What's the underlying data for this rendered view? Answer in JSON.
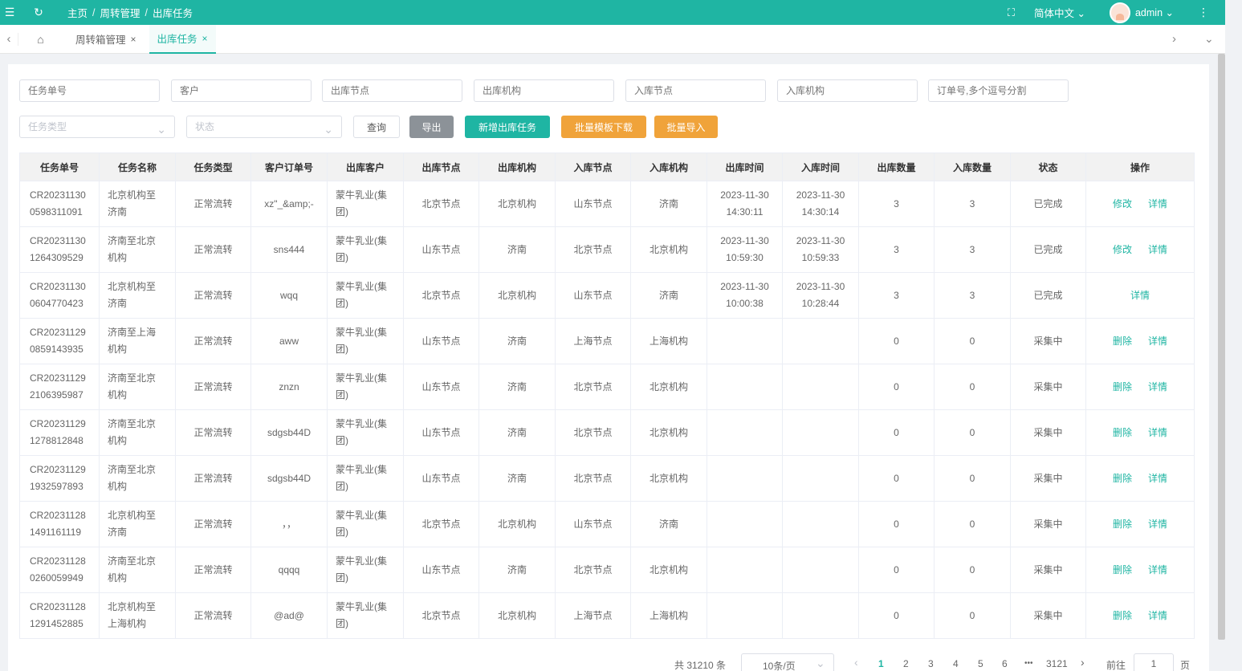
{
  "header": {
    "breadcrumb": [
      "主页",
      "周转管理",
      "出库任务"
    ],
    "breadcrumb_sep": "/",
    "language": "简体中文",
    "user": "admin"
  },
  "tabs": [
    {
      "label": "周转箱管理",
      "close": "×"
    },
    {
      "label": "出库任务",
      "close": "×"
    }
  ],
  "filters": {
    "task_no": "任务单号",
    "customer": "客户",
    "out_node": "出库节点",
    "out_org": "出库机构",
    "in_node": "入库节点",
    "in_org": "入库机构",
    "order_no": "订单号,多个逗号分割",
    "task_type": "任务类型",
    "status": "状态"
  },
  "buttons": {
    "query": "查询",
    "export": "导出",
    "add": "新增出库任务",
    "template": "批量模板下载",
    "import": "批量导入"
  },
  "table": {
    "columns": [
      "任务单号",
      "任务名称",
      "任务类型",
      "客户订单号",
      "出库客户",
      "出库节点",
      "出库机构",
      "入库节点",
      "入库机构",
      "出库时间",
      "入库时间",
      "出库数量",
      "入库数量",
      "状态",
      "操作"
    ],
    "rows": [
      {
        "no1": "CR20231130",
        "no2": "0598311091",
        "name1": "北京机构至",
        "name2": "济南",
        "type": "正常流转",
        "order": "xz\"_&amp;-",
        "cust1": "蒙牛乳业(集",
        "cust2": "团)",
        "out_node": "北京节点",
        "out_org": "北京机构",
        "in_node": "山东节点",
        "in_org": "济南",
        "out_d": "2023-11-30",
        "out_t": "14:30:11",
        "in_d": "2023-11-30",
        "in_t": "14:30:14",
        "out_qty": "3",
        "in_qty": "3",
        "status": "已完成",
        "op1": "修改",
        "op2": "详情"
      },
      {
        "no1": "CR20231130",
        "no2": "1264309529",
        "name1": "济南至北京",
        "name2": "机构",
        "type": "正常流转",
        "order": "sns444",
        "cust1": "蒙牛乳业(集",
        "cust2": "团)",
        "out_node": "山东节点",
        "out_org": "济南",
        "in_node": "北京节点",
        "in_org": "北京机构",
        "out_d": "2023-11-30",
        "out_t": "10:59:30",
        "in_d": "2023-11-30",
        "in_t": "10:59:33",
        "out_qty": "3",
        "in_qty": "3",
        "status": "已完成",
        "op1": "修改",
        "op2": "详情"
      },
      {
        "no1": "CR20231130",
        "no2": "0604770423",
        "name1": "北京机构至",
        "name2": "济南",
        "type": "正常流转",
        "order": "wqq",
        "cust1": "蒙牛乳业(集",
        "cust2": "团)",
        "out_node": "北京节点",
        "out_org": "北京机构",
        "in_node": "山东节点",
        "in_org": "济南",
        "out_d": "2023-11-30",
        "out_t": "10:00:38",
        "in_d": "2023-11-30",
        "in_t": "10:28:44",
        "out_qty": "3",
        "in_qty": "3",
        "status": "已完成",
        "op1": "",
        "op2": "详情"
      },
      {
        "no1": "CR20231129",
        "no2": "0859143935",
        "name1": "济南至上海",
        "name2": "机构",
        "type": "正常流转",
        "order": "aww",
        "cust1": "蒙牛乳业(集",
        "cust2": "团)",
        "out_node": "山东节点",
        "out_org": "济南",
        "in_node": "上海节点",
        "in_org": "上海机构",
        "out_d": "",
        "out_t": "",
        "in_d": "",
        "in_t": "",
        "out_qty": "0",
        "in_qty": "0",
        "status": "采集中",
        "op1": "删除",
        "op2": "详情"
      },
      {
        "no1": "CR20231129",
        "no2": "2106395987",
        "name1": "济南至北京",
        "name2": "机构",
        "type": "正常流转",
        "order": "znzn",
        "cust1": "蒙牛乳业(集",
        "cust2": "团)",
        "out_node": "山东节点",
        "out_org": "济南",
        "in_node": "北京节点",
        "in_org": "北京机构",
        "out_d": "",
        "out_t": "",
        "in_d": "",
        "in_t": "",
        "out_qty": "0",
        "in_qty": "0",
        "status": "采集中",
        "op1": "删除",
        "op2": "详情"
      },
      {
        "no1": "CR20231129",
        "no2": "1278812848",
        "name1": "济南至北京",
        "name2": "机构",
        "type": "正常流转",
        "order": "sdgsb44D",
        "cust1": "蒙牛乳业(集",
        "cust2": "团)",
        "out_node": "山东节点",
        "out_org": "济南",
        "in_node": "北京节点",
        "in_org": "北京机构",
        "out_d": "",
        "out_t": "",
        "in_d": "",
        "in_t": "",
        "out_qty": "0",
        "in_qty": "0",
        "status": "采集中",
        "op1": "删除",
        "op2": "详情"
      },
      {
        "no1": "CR20231129",
        "no2": "1932597893",
        "name1": "济南至北京",
        "name2": "机构",
        "type": "正常流转",
        "order": "sdgsb44D",
        "cust1": "蒙牛乳业(集",
        "cust2": "团)",
        "out_node": "山东节点",
        "out_org": "济南",
        "in_node": "北京节点",
        "in_org": "北京机构",
        "out_d": "",
        "out_t": "",
        "in_d": "",
        "in_t": "",
        "out_qty": "0",
        "in_qty": "0",
        "status": "采集中",
        "op1": "删除",
        "op2": "详情"
      },
      {
        "no1": "CR20231128",
        "no2": "1491161119",
        "name1": "北京机构至",
        "name2": "济南",
        "type": "正常流转",
        "order": "，，",
        "cust1": "蒙牛乳业(集",
        "cust2": "团)",
        "out_node": "北京节点",
        "out_org": "北京机构",
        "in_node": "山东节点",
        "in_org": "济南",
        "out_d": "",
        "out_t": "",
        "in_d": "",
        "in_t": "",
        "out_qty": "0",
        "in_qty": "0",
        "status": "采集中",
        "op1": "删除",
        "op2": "详情"
      },
      {
        "no1": "CR20231128",
        "no2": "0260059949",
        "name1": "济南至北京",
        "name2": "机构",
        "type": "正常流转",
        "order": "qqqq",
        "cust1": "蒙牛乳业(集",
        "cust2": "团)",
        "out_node": "山东节点",
        "out_org": "济南",
        "in_node": "北京节点",
        "in_org": "北京机构",
        "out_d": "",
        "out_t": "",
        "in_d": "",
        "in_t": "",
        "out_qty": "0",
        "in_qty": "0",
        "status": "采集中",
        "op1": "删除",
        "op2": "详情"
      },
      {
        "no1": "CR20231128",
        "no2": "1291452885",
        "name1": "北京机构至",
        "name2": "上海机构",
        "type": "正常流转",
        "order": "@ad@",
        "cust1": "蒙牛乳业(集",
        "cust2": "团)",
        "out_node": "北京节点",
        "out_org": "北京机构",
        "in_node": "上海节点",
        "in_org": "上海机构",
        "out_d": "",
        "out_t": "",
        "in_d": "",
        "in_t": "",
        "out_qty": "0",
        "in_qty": "0",
        "status": "采集中",
        "op1": "删除",
        "op2": "详情"
      }
    ]
  },
  "pagination": {
    "total": "共 31210 条",
    "page_size": "10条/页",
    "prev": "‹",
    "pages": [
      "1",
      "2",
      "3",
      "4",
      "5",
      "6"
    ],
    "ellipsis": "•••",
    "last": "3121",
    "next": "›",
    "goto": "前往",
    "goto_value": "1",
    "page_unit": "页"
  },
  "colors": {
    "accent": "#1fb5a3",
    "orange": "#f0a33a",
    "gray_btn": "#8c9298"
  }
}
